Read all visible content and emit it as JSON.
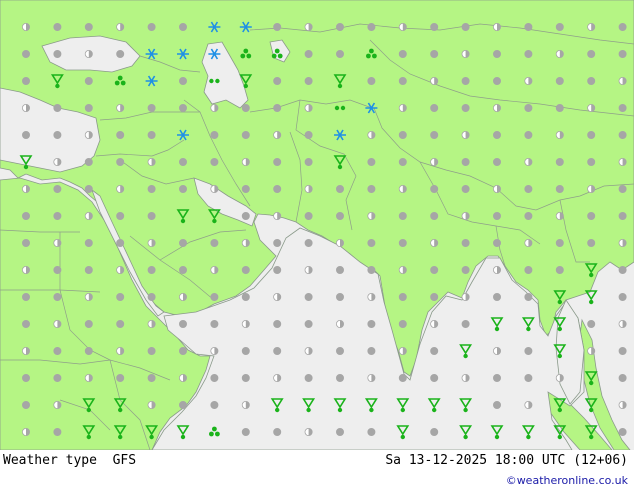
{
  "footer": {
    "title": "Weather type  GFS",
    "datetime": "Sa 13-12-2025 18:00 UTC (12+06)",
    "credit": "©weatheronline.co.uk"
  },
  "colors": {
    "sea": "#eeeeee",
    "land": "#b5f584",
    "border": "#7f9e7a",
    "coast": "#8a9a8a",
    "dot": "#a6a6a6",
    "rain": "#1ab31a",
    "snow": "#1e90e6"
  },
  "map": {
    "projection": "regular lon/lat grid",
    "symbol_types": [
      "cloudy-dot",
      "rain",
      "showers",
      "snow",
      "snow-showers",
      "drizzle"
    ]
  }
}
